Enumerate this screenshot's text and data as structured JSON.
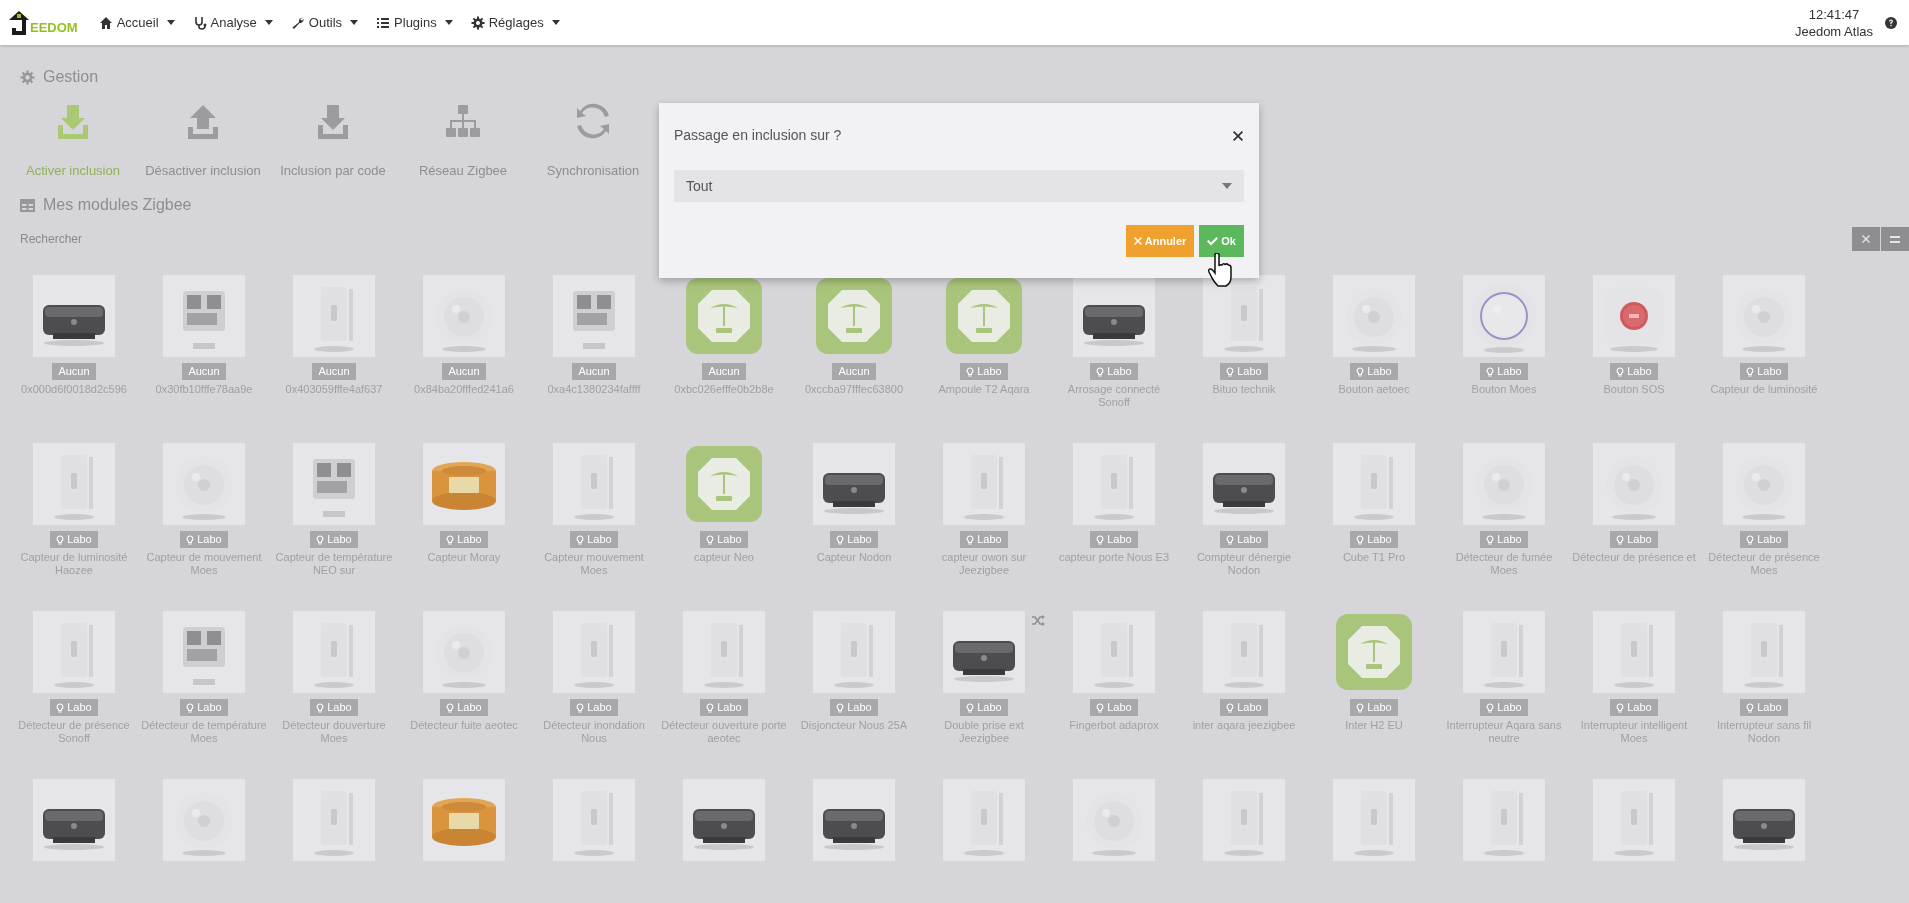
{
  "navbar": {
    "logo": "EEDOM",
    "menus": [
      {
        "label": "Accueil"
      },
      {
        "label": "Analyse"
      },
      {
        "label": "Outils"
      },
      {
        "label": "Plugins"
      },
      {
        "label": "Réglages"
      }
    ],
    "time": "12:41:47",
    "user": "Jeedom Atlas"
  },
  "gestion": {
    "title": "Gestion",
    "actions": [
      {
        "label": "Activer inclusion",
        "active": true
      },
      {
        "label": "Désactiver inclusion",
        "active": false
      },
      {
        "label": "Inclusion par code",
        "active": false
      },
      {
        "label": "Réseau Zigbee",
        "active": false
      },
      {
        "label": "Synchronisation",
        "active": false
      }
    ]
  },
  "modules": {
    "title": "Mes modules Zigbee",
    "search": {
      "placeholder": "Rechercher"
    },
    "rows": [
      [
        {
          "name": "0x000d6f0018d2c596",
          "badge": {
            "text": "Aucun",
            "kind": "plain"
          },
          "kind": "dark"
        },
        {
          "name": "0x30fb10fffe78aa9e",
          "badge": {
            "text": "Aucun",
            "kind": "plain"
          },
          "kind": "display"
        },
        {
          "name": "0x403059fffe4af637",
          "badge": {
            "text": "Aucun",
            "kind": "plain"
          },
          "kind": "box"
        },
        {
          "name": "0x84ba20fffed241a6",
          "badge": {
            "text": "Aucun",
            "kind": "plain"
          },
          "kind": "round"
        },
        {
          "name": "0xa4c1380234faffff",
          "badge": {
            "text": "Aucun",
            "kind": "plain"
          },
          "kind": "display"
        },
        {
          "name": "0xbc026efffe0b2b8e",
          "badge": {
            "text": "Aucun",
            "kind": "plain"
          },
          "kind": "placeholder"
        },
        {
          "name": "0xccba97fffec63800",
          "badge": {
            "text": "Aucun",
            "kind": "plain"
          },
          "kind": "placeholder"
        },
        {
          "name": "Ampoule T2 Aqara",
          "badge": {
            "text": "Labo",
            "kind": "bulb"
          },
          "kind": "placeholder"
        },
        {
          "name": "Arrosage connecté Sonoff",
          "badge": {
            "text": "Labo",
            "kind": "bulb"
          },
          "kind": "dark"
        },
        {
          "name": "Bituo technik",
          "badge": {
            "text": "Labo",
            "kind": "bulb"
          },
          "kind": "box"
        },
        {
          "name": "Bouton aetoec",
          "badge": {
            "text": "Labo",
            "kind": "bulb"
          },
          "kind": "round"
        },
        {
          "name": "Bouton Moes",
          "badge": {
            "text": "Labo",
            "kind": "bulb"
          },
          "kind": "ring"
        },
        {
          "name": "Bouton SOS",
          "badge": {
            "text": "Labo",
            "kind": "bulb"
          },
          "kind": "sos"
        },
        {
          "name": "Capteur de luminosité",
          "badge": {
            "text": "Labo",
            "kind": "bulb"
          },
          "kind": "round"
        }
      ],
      [
        {
          "name": "Capteur de luminosité Haozee",
          "badge": {
            "text": "Labo",
            "kind": "bulb"
          },
          "kind": "box"
        },
        {
          "name": "Capteur de mouvement Moes",
          "badge": {
            "text": "Labo",
            "kind": "bulb"
          },
          "kind": "round"
        },
        {
          "name": "Capteur de température NEO sur",
          "badge": {
            "text": "Labo",
            "kind": "bulb"
          },
          "kind": "display"
        },
        {
          "name": "Capteur Moray",
          "badge": {
            "text": "Labo",
            "kind": "bulb"
          },
          "kind": "orange"
        },
        {
          "name": "Capteur mouvement Moes",
          "badge": {
            "text": "Labo",
            "kind": "bulb"
          },
          "kind": "box"
        },
        {
          "name": "capteur Neo",
          "badge": {
            "text": "Labo",
            "kind": "bulb"
          },
          "kind": "placeholder"
        },
        {
          "name": "Capteur Nodon",
          "badge": {
            "text": "Labo",
            "kind": "bulb"
          },
          "kind": "dark"
        },
        {
          "name": "capteur owon sur Jeezigbee",
          "badge": {
            "text": "Labo",
            "kind": "bulb"
          },
          "kind": "box"
        },
        {
          "name": "capteur porte Nous E3",
          "badge": {
            "text": "Labo",
            "kind": "bulb"
          },
          "kind": "box"
        },
        {
          "name": "Compteur dénergie Nodon",
          "badge": {
            "text": "Labo",
            "kind": "bulb"
          },
          "kind": "dark"
        },
        {
          "name": "Cube T1 Pro",
          "badge": {
            "text": "Labo",
            "kind": "bulb"
          },
          "kind": "box"
        },
        {
          "name": "Détecteur de fumée Moes",
          "badge": {
            "text": "Labo",
            "kind": "bulb"
          },
          "kind": "round"
        },
        {
          "name": "Détecteur de présence et",
          "badge": {
            "text": "Labo",
            "kind": "bulb"
          },
          "kind": "round"
        },
        {
          "name": "Détecteur de présence Moes",
          "badge": {
            "text": "Labo",
            "kind": "bulb"
          },
          "kind": "round"
        }
      ],
      [
        {
          "name": "Détecteur de présence Sonoff",
          "badge": {
            "text": "Labo",
            "kind": "bulb"
          },
          "kind": "box"
        },
        {
          "name": "Détecteur de température Moes",
          "badge": {
            "text": "Labo",
            "kind": "bulb"
          },
          "kind": "display"
        },
        {
          "name": "Détecteur douverture Moes",
          "badge": {
            "text": "Labo",
            "kind": "bulb"
          },
          "kind": "box"
        },
        {
          "name": "Détecteur fuite aeotec",
          "badge": {
            "text": "Labo",
            "kind": "bulb"
          },
          "kind": "round"
        },
        {
          "name": "Détecteur inondation Nous",
          "badge": {
            "text": "Labo",
            "kind": "bulb"
          },
          "kind": "box"
        },
        {
          "name": "Détecteur ouverture porte aeotec",
          "badge": {
            "text": "Labo",
            "kind": "bulb"
          },
          "kind": "box"
        },
        {
          "name": "Disjoncteur Nous 25A",
          "badge": {
            "text": "Labo",
            "kind": "bulb"
          },
          "kind": "box"
        },
        {
          "name": "Double prise ext Jeezigbee",
          "badge": {
            "text": "Labo",
            "kind": "bulb"
          },
          "kind": "dark",
          "shuffle": true
        },
        {
          "name": "Fingerbot adaprox",
          "badge": {
            "text": "Labo",
            "kind": "bulb"
          },
          "kind": "box"
        },
        {
          "name": "inter aqara jeezigbee",
          "badge": {
            "text": "Labo",
            "kind": "bulb"
          },
          "kind": "box"
        },
        {
          "name": "Inter H2 EU",
          "badge": {
            "text": "Labo",
            "kind": "bulb"
          },
          "kind": "placeholder"
        },
        {
          "name": "Interrupteur Aqara sans neutre",
          "badge": {
            "text": "Labo",
            "kind": "bulb"
          },
          "kind": "box"
        },
        {
          "name": "Interrupteur intelligent Moes",
          "badge": {
            "text": "Labo",
            "kind": "bulb"
          },
          "kind": "box"
        },
        {
          "name": "Interrupteur sans fil Nodon",
          "badge": {
            "text": "Labo",
            "kind": "bulb"
          },
          "kind": "box"
        }
      ],
      [
        {
          "kind": "dark"
        },
        {
          "kind": "round"
        },
        {
          "kind": "box"
        },
        {
          "kind": "orange"
        },
        {
          "kind": "box"
        },
        {
          "kind": "dark"
        },
        {
          "kind": "dark"
        },
        {
          "kind": "box"
        },
        {
          "kind": "round"
        },
        {
          "kind": "box"
        },
        {
          "kind": "box"
        },
        {
          "kind": "box"
        },
        {
          "kind": "box"
        },
        {
          "kind": "dark"
        }
      ]
    ]
  },
  "modal": {
    "title": "Passage en inclusion sur ?",
    "select": "Tout",
    "buttons": [
      {
        "label": "Annuler",
        "kind": "cancel"
      },
      {
        "label": "Ok",
        "kind": "ok"
      }
    ]
  }
}
